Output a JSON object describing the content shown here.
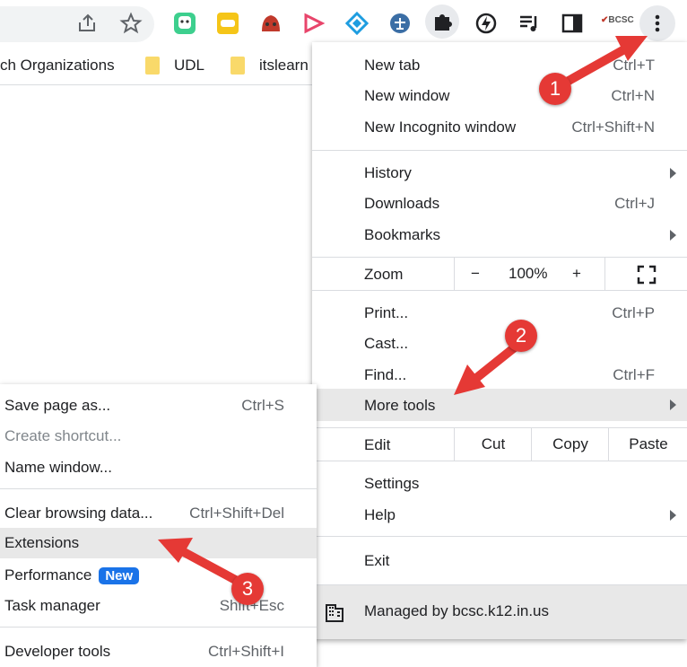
{
  "toolbar": {
    "icons": [
      "share-icon",
      "star-icon",
      "bitmoji-icon",
      "chat-ext-icon",
      "ladybug-ext-icon",
      "screencast-ext-icon",
      "diamond-ext-icon",
      "scale-ext-icon",
      "puzzle-extensions-icon",
      "lightning-ext-icon",
      "media-queue-icon",
      "side-panel-icon",
      "bcsc-logo-icon",
      "kebab-menu-icon"
    ],
    "bcsc_logo_text": "BCSC"
  },
  "bookmarks_bar": {
    "items": [
      "ch Organizations",
      "UDL",
      "itslearn"
    ]
  },
  "main_menu": {
    "new_tab": {
      "label": "New tab",
      "shortcut": "Ctrl+T"
    },
    "new_window": {
      "label": "New window",
      "shortcut": "Ctrl+N"
    },
    "new_incognito": {
      "label": "New Incognito window",
      "shortcut": "Ctrl+Shift+N"
    },
    "history": {
      "label": "History"
    },
    "downloads": {
      "label": "Downloads",
      "shortcut": "Ctrl+J"
    },
    "bookmarks": {
      "label": "Bookmarks"
    },
    "zoom": {
      "label": "Zoom",
      "minus": "−",
      "value": "100%",
      "plus": "+"
    },
    "print": {
      "label": "Print...",
      "shortcut": "Ctrl+P"
    },
    "cast": {
      "label": "Cast..."
    },
    "find": {
      "label": "Find...",
      "shortcut": "Ctrl+F"
    },
    "more_tools": {
      "label": "More tools"
    },
    "edit": {
      "label": "Edit",
      "cut": "Cut",
      "copy": "Copy",
      "paste": "Paste"
    },
    "settings": {
      "label": "Settings"
    },
    "help": {
      "label": "Help"
    },
    "exit": {
      "label": "Exit"
    },
    "managed": {
      "label": "Managed by bcsc.k12.in.us"
    }
  },
  "sub_menu": {
    "save_page": {
      "label": "Save page as...",
      "shortcut": "Ctrl+S"
    },
    "create_shortcut": {
      "label": "Create shortcut..."
    },
    "name_window": {
      "label": "Name window..."
    },
    "clear_data": {
      "label": "Clear browsing data...",
      "shortcut": "Ctrl+Shift+Del"
    },
    "extensions": {
      "label": "Extensions"
    },
    "performance": {
      "label": "Performance",
      "badge": "New"
    },
    "task_manager": {
      "label": "Task manager",
      "shortcut": "Shift+Esc"
    },
    "developer_tools": {
      "label": "Developer tools",
      "shortcut": "Ctrl+Shift+I"
    }
  },
  "callouts": [
    "1",
    "2",
    "3"
  ],
  "colors": {
    "callout": "#e53935",
    "highlight": "#e8e8e8",
    "badge": "#1a73e8"
  }
}
